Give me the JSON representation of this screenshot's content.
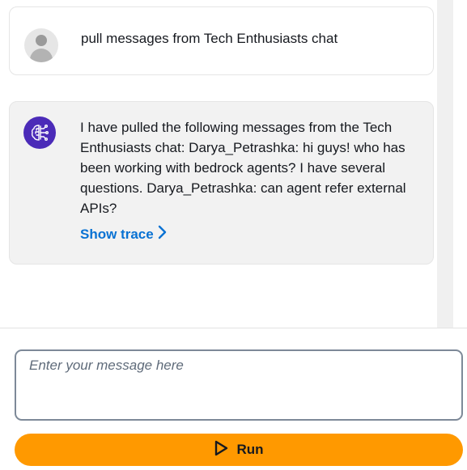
{
  "conversation": {
    "user_message": {
      "avatar_icon": "user-avatar-icon",
      "text": "pull messages from Tech Enthusiasts chat"
    },
    "agent_message": {
      "avatar_icon": "brain-circuit-icon",
      "avatar_color": "#4b2bb8",
      "text": "I have pulled the following messages from the Tech Enthusiasts chat: Darya_Petrashka: hi guys! who has been working with bedrock agents? I have several questions. Darya_Petrashka: can agent refer external APIs?",
      "show_trace_label": "Show trace",
      "link_color": "#0972d3"
    }
  },
  "composer": {
    "placeholder": "Enter your message here",
    "value": "",
    "run_label": "Run",
    "run_color": "#ff9900"
  }
}
